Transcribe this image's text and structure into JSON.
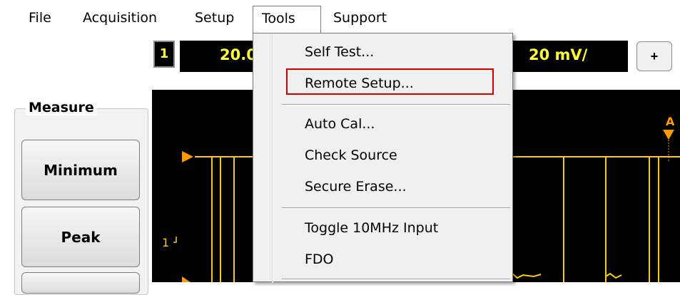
{
  "menubar": {
    "items": [
      "File",
      "Acquisition",
      "Setup",
      "Tools",
      "Support"
    ],
    "open": "Tools"
  },
  "channel": {
    "number": "1",
    "scale_left": "20.0",
    "scale_right": "20 mV/",
    "plus_label": "+"
  },
  "measure": {
    "title": "Measure",
    "buttons": [
      "Minimum",
      "Peak"
    ]
  },
  "scope": {
    "marker_label": "1",
    "annotation": "A"
  },
  "tools_menu": {
    "items": [
      {
        "label": "Self Test..."
      },
      {
        "label": "Remote Setup...",
        "highlighted": true
      },
      {
        "label": "Auto Cal..."
      },
      {
        "label": "Check Source"
      },
      {
        "label": "Secure Erase..."
      },
      {
        "label": "Toggle 10MHz Input"
      },
      {
        "label": "FDO"
      }
    ]
  },
  "colors": {
    "trace": "#ffcc00",
    "marker": "#ff9900",
    "highlight": "#d40000"
  }
}
